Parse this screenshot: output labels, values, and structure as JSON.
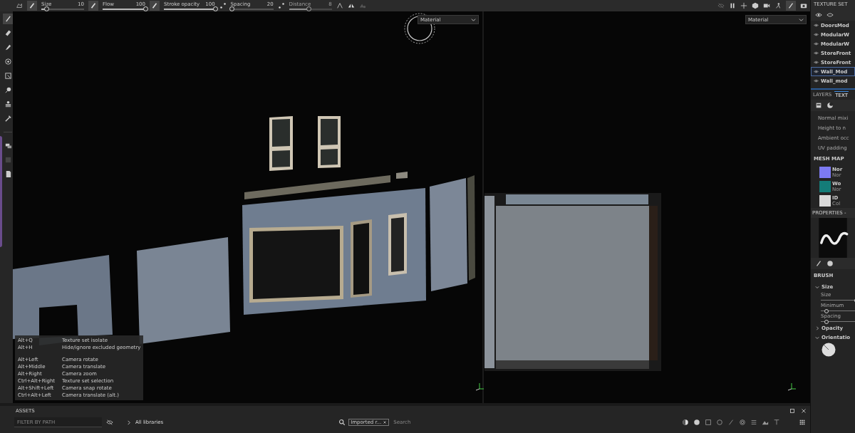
{
  "toolbar": {
    "sliders": [
      {
        "label": "Size",
        "value": "10",
        "level": 0.12,
        "disabled": false
      },
      {
        "label": "Flow",
        "value": "100",
        "level": 1,
        "disabled": false
      },
      {
        "label": "Stroke opacity",
        "value": "100",
        "level": 1,
        "disabled": false
      },
      {
        "label": "Spacing",
        "value": "20",
        "level": 0.03,
        "disabled": false
      },
      {
        "label": "Distance",
        "value": "8",
        "level": 0.45,
        "disabled": true
      }
    ]
  },
  "viewport_3d": {
    "dropdown": "Material"
  },
  "viewport_2d": {
    "dropdown": "Material"
  },
  "shortcuts": [
    [
      {
        "keys": "Alt+Q",
        "action": "Texture set isolate"
      },
      {
        "keys": "Alt+H",
        "action": "Hide/ignore excluded geometry"
      }
    ],
    [
      {
        "keys": "Alt+Left",
        "action": "Camera rotate"
      },
      {
        "keys": "Alt+Middle",
        "action": "Camera translate"
      },
      {
        "keys": "Alt+Right",
        "action": "Camera zoom"
      },
      {
        "keys": "Ctrl+Alt+Right",
        "action": "Texture set selection"
      },
      {
        "keys": "Alt+Shift+Left",
        "action": "Camera snap rotate"
      },
      {
        "keys": "Ctrl+Alt+Left",
        "action": "Camera translate (alt.)"
      }
    ]
  ],
  "texture_set_list": {
    "title": "TEXTURE SET",
    "items": [
      {
        "name": "DoorsMod",
        "selected": false
      },
      {
        "name": "ModularW",
        "selected": false
      },
      {
        "name": "ModularW",
        "selected": false
      },
      {
        "name": "StoreFront",
        "selected": false
      },
      {
        "name": "StoreFront",
        "selected": false
      },
      {
        "name": "Wall_Mod",
        "selected": true
      },
      {
        "name": "Wall_mod",
        "selected": false
      }
    ]
  },
  "settings_tabs": [
    {
      "label": "LAYERS",
      "selected": false
    },
    {
      "label": "TEXT",
      "selected": true
    }
  ],
  "settings": [
    "Normal mixi",
    "Height to n",
    "Ambient occ",
    "UV padding"
  ],
  "mesh_maps": {
    "title": "MESH MAP",
    "items": [
      {
        "name": "Nor",
        "sub": "Nor",
        "color": "#7d7af2"
      },
      {
        "name": "Wo",
        "sub": "Nor",
        "color": "#147c78"
      },
      {
        "name": "ID",
        "sub": "Col",
        "color": "#d9d9d9"
      }
    ]
  },
  "properties": {
    "title": "PROPERTIES -",
    "section": "BRUSH",
    "groups": [
      {
        "label": "Size",
        "expanded": true,
        "kind": "sliders",
        "params": [
          {
            "label": "Size",
            "level": 1
          },
          {
            "label": "Minimum",
            "level": 0.15
          },
          {
            "label": "Spacing",
            "level": 0.15
          }
        ]
      },
      {
        "label": "Opacity",
        "expanded": false
      },
      {
        "label": "Orientatio",
        "expanded": true,
        "kind": "dial"
      }
    ]
  },
  "assets": {
    "title": "ASSETS",
    "filter_placeholder": "FILTER BY PATH",
    "library": "All libraries",
    "chip": "Imported r...",
    "search_placeholder": "Search"
  }
}
